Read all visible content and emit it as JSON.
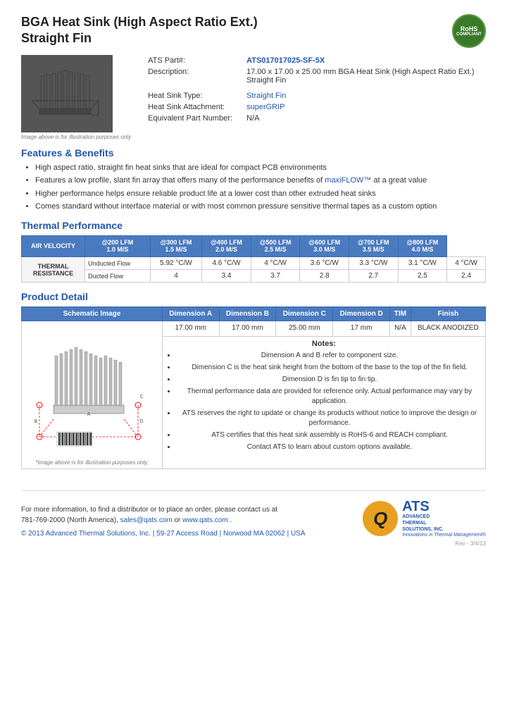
{
  "page": {
    "title_line1": "BGA Heat Sink (High Aspect Ratio Ext.)",
    "title_line2": "Straight Fin"
  },
  "product": {
    "part_label": "ATS Part#:",
    "part_number": "ATS017017025-SF-5X",
    "description_label": "Description:",
    "description_value": "17.00 x 17.00 x 25.00 mm BGA Heat Sink (High Aspect Ratio Ext.) Straight Fin",
    "heat_sink_type_label": "Heat Sink Type:",
    "heat_sink_type_value": "Straight Fin",
    "heat_sink_attachment_label": "Heat Sink Attachment:",
    "heat_sink_attachment_value": "superGRIP",
    "equivalent_part_label": "Equivalent Part Number:",
    "equivalent_part_value": "N/A",
    "image_caption": "Image above is for illustration purposes only"
  },
  "features": {
    "heading": "Features & Benefits",
    "items": [
      "High aspect ratio, straight fin heat sinks that are ideal for compact PCB environments",
      "Features a low profile, slant fin array that offers many of the performance benefits of maxiFLOW™ at a great value",
      "Higher performance helps ensure reliable product life at a lower cost than other extruded heat sinks",
      "Comes standard without interface material or with most common pressure sensitive thermal tapes as a custom option"
    ]
  },
  "thermal": {
    "heading": "Thermal Performance",
    "col_headers": [
      "AIR VELOCITY",
      "@200 LFM\n1.0 M/S",
      "@300 LFM\n1.5 M/S",
      "@400 LFM\n2.0 M/S",
      "@500 LFM\n2.5 M/S",
      "@600 LFM\n3.0 M/S",
      "@700 LFM\n3.5 M/S",
      "@800 LFM\n4.0 M/S"
    ],
    "row_label": "THERMAL RESISTANCE",
    "rows": [
      {
        "label": "Unducted Flow",
        "values": [
          "5.92 °C/W",
          "4.6 °C/W",
          "4 °C/W",
          "3.6 °C/W",
          "3.3 °C/W",
          "3.1 °C/W",
          "4 °C/W"
        ]
      },
      {
        "label": "Ducted Flow",
        "values": [
          "4",
          "3.4",
          "3.7",
          "2.8",
          "2.7",
          "2.5",
          "2.4"
        ]
      }
    ]
  },
  "product_detail": {
    "heading": "Product Detail",
    "table_headers": [
      "Schematic Image",
      "Dimension A",
      "Dimension B",
      "Dimension C",
      "Dimension D",
      "TIM",
      "Finish"
    ],
    "dimension_a": "17.00 mm",
    "dimension_b": "17.00 mm",
    "dimension_c": "25.00 mm",
    "dimension_d": "17 mm",
    "tim": "N/A",
    "finish": "BLACK ANODIZED",
    "notes_title": "Notes:",
    "notes": [
      "Dimension A and B refer to component size.",
      "Dimension C is the heat sink height from the bottom of the base to the top of the fin field.",
      "Dimension D is fin tip to fin tip.",
      "Thermal performance data are provided for reference only. Actual performance may vary by application.",
      "ATS reserves the right to update or change its products without notice to improve the design or performance.",
      "ATS certifies that this heat sink assembly is RoHS-6 and REACH compliant.",
      "Contact ATS to learn about custom options available."
    ],
    "image_caption": "*Image above is for illustration purposes only."
  },
  "footer": {
    "contact_text": "For more information, to find a distributor or to place an order, please contact us at 781-769-2000 (North America),",
    "email": "sales@qats.com",
    "email_connector": " or ",
    "website": "www.qats.com",
    "website_suffix": ".",
    "copyright": "© 2013 Advanced Thermal Solutions, Inc. | 59-27 Access Road | Norwood MA  02062 | USA",
    "rev": "Rev - 3/4/13"
  },
  "rohs": {
    "line1": "RoHS",
    "line2": "COMPLIANT"
  },
  "ats_logo": {
    "q_letter": "Q",
    "acronym": "ATS",
    "line1": "ADVANCED",
    "line2": "THERMAL",
    "line3": "SOLUTIONS, INC.",
    "tagline": "Innovations in Thermal Management®"
  }
}
